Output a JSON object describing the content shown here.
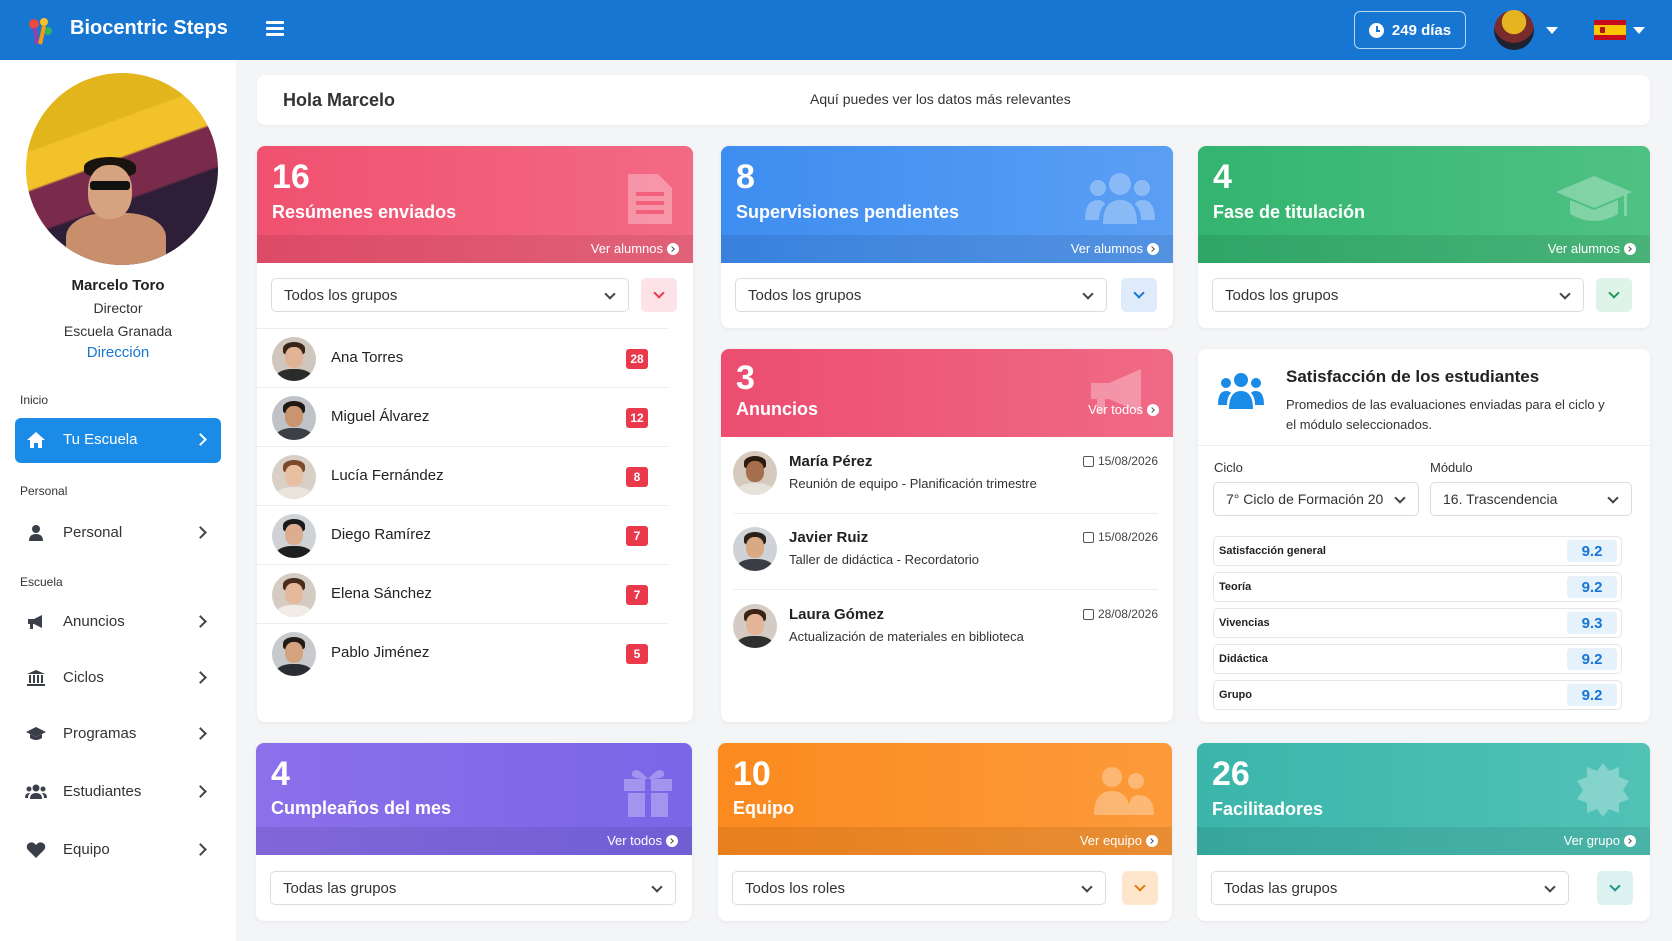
{
  "app": {
    "brand": "Biocentric Steps"
  },
  "topbar": {
    "days_label": "249 días"
  },
  "profile": {
    "name": "Marcelo Toro",
    "role": "Director",
    "school": "Escuela Granada",
    "link": "Dirección"
  },
  "sidebar": {
    "sections": {
      "inicio": "Inicio",
      "personal": "Personal",
      "escuela": "Escuela"
    },
    "items": [
      {
        "label": "Tu Escuela",
        "icon": "home-icon",
        "active": true
      },
      {
        "label": "Personal",
        "icon": "user-icon"
      },
      {
        "label": "Anuncios",
        "icon": "megaphone-icon"
      },
      {
        "label": "Ciclos",
        "icon": "institution-icon"
      },
      {
        "label": "Programas",
        "icon": "graduation-cap-icon"
      },
      {
        "label": "Estudiantes",
        "icon": "users-icon"
      },
      {
        "label": "Equipo",
        "icon": "heart-icon"
      }
    ]
  },
  "greeting": {
    "hello": "Hola Marcelo",
    "subtitle": "Aquí puedes ver los datos más relevantes"
  },
  "cards": {
    "resumenes": {
      "count": "16",
      "title": "Resúmenes enviados",
      "link": "Ver alumnos",
      "filter": "Todos los grupos",
      "color": "#ee4d6c"
    },
    "supervisiones": {
      "count": "8",
      "title": "Supervisiones pendientes",
      "link": "Ver alumnos",
      "filter": "Todos los grupos",
      "color": "#3e8df0"
    },
    "titulacion": {
      "count": "4",
      "title": "Fase de titulación",
      "link": "Ver alumnos",
      "filter": "Todos los grupos",
      "color": "#33b46f"
    },
    "anuncios": {
      "count": "3",
      "title": "Anuncios",
      "link": "Ver todos",
      "color": "#ec4d70"
    },
    "cumpleanos": {
      "count": "4",
      "title": "Cumpleaños del mes",
      "link": "Ver todos",
      "filter": "Todas las grupos",
      "color": "#7a66e8"
    },
    "equipo": {
      "count": "10",
      "title": "Equipo",
      "link": "Ver equipo",
      "filter": "Todos los roles",
      "color": "#fb8a1f"
    },
    "facilitadores": {
      "count": "26",
      "title": "Facilitadores",
      "link": "Ver grupo",
      "filter": "Todas las grupos",
      "color": "#3bb5aa"
    }
  },
  "students": [
    {
      "name": "Ana Torres",
      "count": "28"
    },
    {
      "name": "Miguel Álvarez",
      "count": "12"
    },
    {
      "name": "Lucía Fernández",
      "count": "8"
    },
    {
      "name": "Diego Ramírez",
      "count": "7"
    },
    {
      "name": "Elena Sánchez",
      "count": "7"
    },
    {
      "name": "Pablo Jiménez",
      "count": "5"
    }
  ],
  "announcements": [
    {
      "author": "María Pérez",
      "text": "Reunión de equipo - Planificación trimestre",
      "date": "15/08/2026"
    },
    {
      "author": "Javier Ruiz",
      "text": "Taller de didáctica - Recordatorio",
      "date": "15/08/2026"
    },
    {
      "author": "Laura Gómez",
      "text": "Actualización de materiales en biblioteca",
      "date": "28/08/2026"
    }
  ],
  "satisfaction": {
    "title": "Satisfacción de los estudiantes",
    "description": "Promedios de las evaluaciones enviadas para el ciclo y el módulo seleccionados.",
    "ciclo_label": "Ciclo",
    "ciclo_value": "7° Ciclo de Formación 20",
    "modulo_label": "Módulo",
    "modulo_value": "16. Trascendencia",
    "metrics": [
      {
        "label": "Satisfacción general",
        "value": "9.2"
      },
      {
        "label": "Teoría",
        "value": "9.2"
      },
      {
        "label": "Vivencias",
        "value": "9.3"
      },
      {
        "label": "Didáctica",
        "value": "9.2"
      },
      {
        "label": "Grupo",
        "value": "9.2"
      }
    ]
  }
}
